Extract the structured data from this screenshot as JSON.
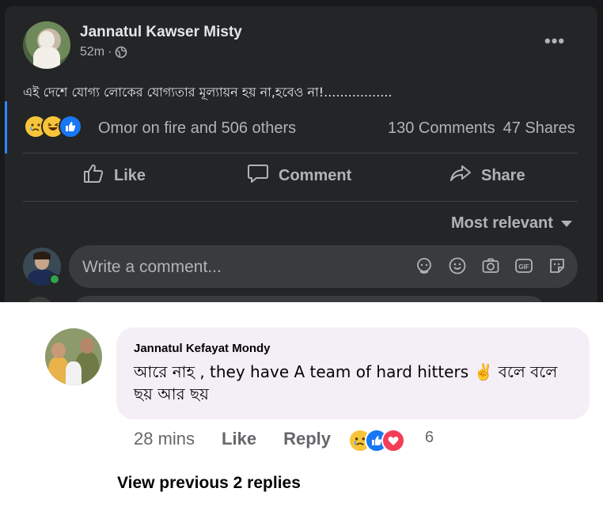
{
  "post": {
    "author": "Jannatul Kawser Misty",
    "time": "52m",
    "separator": "·",
    "more_glyph": "•••",
    "text": "এই দেশে যোগ্য লোকের যোগ্যতার মূল্যায়ন হয় না,হবেও না!.................",
    "reactions_text": "Omor on fire and 506 others",
    "comments_count": "130 Comments",
    "shares_count": "47 Shares",
    "actions": {
      "like": "Like",
      "comment": "Comment",
      "share": "Share"
    },
    "sort_label": "Most relevant",
    "comment_placeholder": "Write a comment...",
    "comment_icons": [
      "avatar-sticker-icon",
      "emoji-icon",
      "camera-icon",
      "gif-icon",
      "sticker-icon"
    ]
  },
  "reply": {
    "author": "Jannatul Kefayat Mondy",
    "text": "আরে নাহ , they have A team of hard hitters ✌️ বলে বলে ছয় আর ছয়",
    "time": "28 mins",
    "like_label": "Like",
    "reply_label": "Reply",
    "reaction_count": "6",
    "view_previous": "View previous 2 replies"
  },
  "colors": {
    "dark_bg": "#18191a",
    "card_bg": "#242526",
    "accent_blue": "#1877f2",
    "love_red": "#f33e58",
    "bubble_light": "#f4eef6"
  }
}
